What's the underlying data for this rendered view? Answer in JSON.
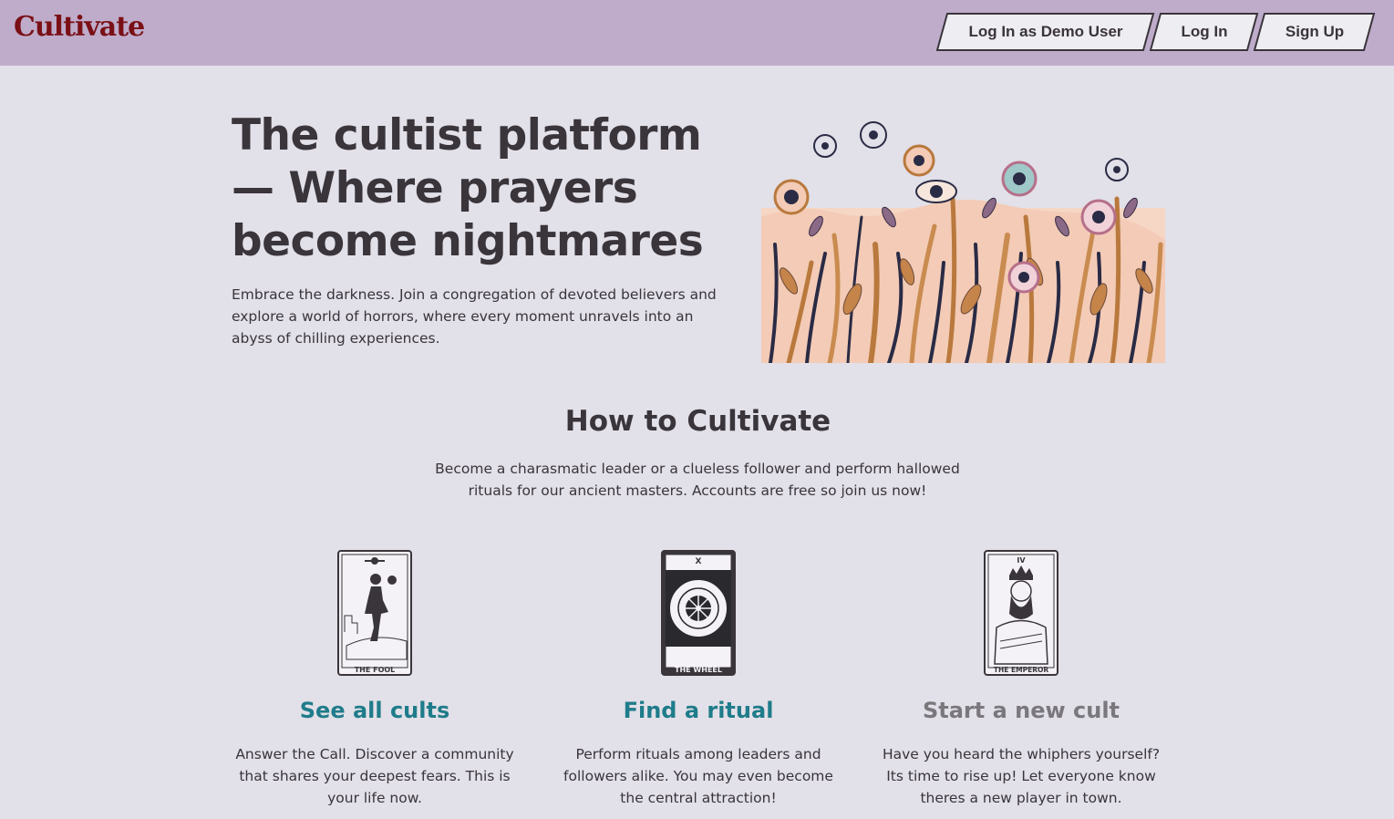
{
  "nav": {
    "logo": "Cultivate",
    "demo_label": "Log In as Demo User",
    "login_label": "Log In",
    "signup_label": "Sign Up"
  },
  "hero": {
    "title": "The cultist platform — Where prayers become nightmares",
    "text": "Embrace the darkness. Join a congregation of devoted believers and explore a world of horrors, where every moment unravels into an abyss of chilling experiences.",
    "image": "eyes-in-flower-field-illustration"
  },
  "how": {
    "title": "How to Cultivate",
    "text": "Become a charasmatic leader or a clueless follower and perform hallowed rituals for our ancient masters. Accounts are free so join us now!"
  },
  "features": [
    {
      "card_label": "THE FOOL",
      "card_numeral": "",
      "title": "See all cults",
      "text": "Answer the Call. Discover a community that shares your deepest fears. This is your life now."
    },
    {
      "card_label": "THE WHEEL",
      "card_numeral": "X",
      "title": "Find a ritual",
      "text": "Perform rituals among leaders and followers alike. You may even become the central attraction!"
    },
    {
      "card_label": "THE EMPEROR",
      "card_numeral": "IV",
      "title": "Start a new cult",
      "text": "Have you heard the whiphers yourself? Its time to rise up! Let everyone know theres a new player in town."
    }
  ],
  "colors": {
    "navbar": "#bfaccb",
    "background": "#e2e0e8",
    "logo": "#7a1016",
    "link": "#1f7c8a",
    "muted": "#7a787d"
  }
}
